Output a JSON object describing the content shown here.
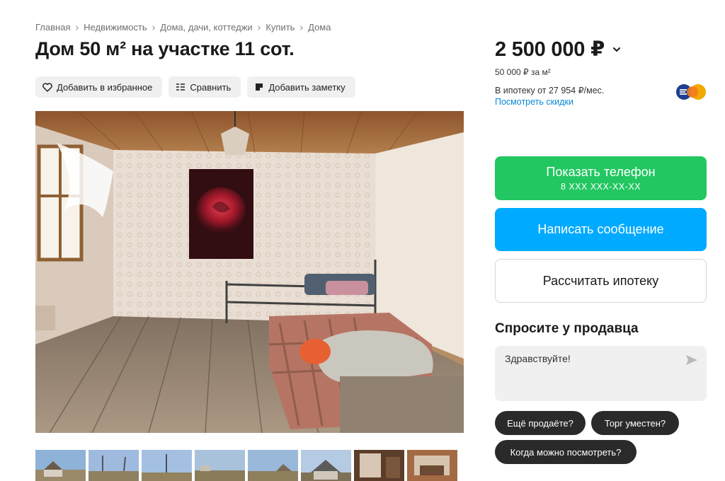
{
  "breadcrumb": [
    "Главная",
    "Недвижимость",
    "Дома, дачи, коттеджи",
    "Купить",
    "Дома"
  ],
  "listing": {
    "title": "Дом 50 м² на участке 11 сот."
  },
  "actions": {
    "favorite": "Добавить в избранное",
    "compare": "Сравнить",
    "note": "Добавить заметку"
  },
  "price": {
    "value": "2 500 000 ₽",
    "per_m2": "50 000 ₽ за м²",
    "mortgage": "В ипотеку от 27 954 ₽/мес.",
    "discounts_link": "Посмотреть скидки"
  },
  "buttons": {
    "phone_label": "Показать телефон",
    "phone_number": "8 XXX XXX-XX-XX",
    "message": "Написать сообщение",
    "mortgage_calc": "Рассчитать ипотеку"
  },
  "ask": {
    "title": "Спросите у продавца",
    "input_value": "Здравствуйте!",
    "chips": [
      "Ещё продаёте?",
      "Торг уместен?",
      "Когда можно посмотреть?"
    ]
  },
  "icons": {
    "favorite": "heart-icon",
    "compare": "compare-icon",
    "note": "note-icon",
    "price_toggle": "chevron-down-icon",
    "send": "send-icon",
    "bank": "bank-logo"
  },
  "colors": {
    "phone_button": "#22c761",
    "message_button": "#00aaff",
    "link": "#0a88d8",
    "chip": "#2a2a2a"
  }
}
